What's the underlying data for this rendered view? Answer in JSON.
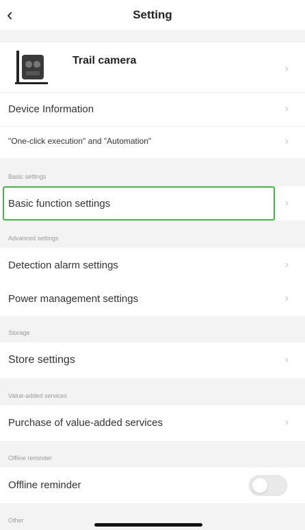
{
  "header": {
    "title": "Setting",
    "back_icon": "chevron-left-icon"
  },
  "device": {
    "name": "Trail camera"
  },
  "rows": {
    "device_information": "Device Information",
    "one_click": "\"One-click execution\" and \"Automation\"",
    "basic_function": "Basic function settings",
    "detection_alarm": "Detection alarm settings",
    "power_management": "Power management settings",
    "store": "Store settings",
    "purchase": "Purchase of value-added services",
    "offline_reminder": "Offline reminder"
  },
  "sections": {
    "basic": "Basic settings",
    "advanced": "Advanced settings",
    "storage": "Storage",
    "value_added": "Value-added services",
    "offline": "Offline reminder",
    "other": "Other"
  },
  "toggle_offline_reminder": {
    "on": false
  },
  "colors": {
    "highlight": "#3dbb3d",
    "background": "#f3f3f3"
  }
}
